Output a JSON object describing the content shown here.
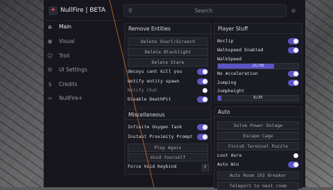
{
  "app": {
    "title": "NullFire | BETA",
    "logo_glyph": "✦"
  },
  "sidebar": {
    "items": [
      {
        "label": "Main",
        "icon": "home-icon",
        "glyph": "⌂",
        "active": true
      },
      {
        "label": "Visual",
        "icon": "eye-icon",
        "glyph": "◉",
        "active": false
      },
      {
        "label": "Troll",
        "icon": "ghost-icon",
        "glyph": "☺",
        "active": false
      },
      {
        "label": "UI Settings",
        "icon": "gear-icon",
        "glyph": "⚙",
        "active": false
      },
      {
        "label": "Credits",
        "icon": "dollar-icon",
        "glyph": "$",
        "active": false
      },
      {
        "label": "NullFire+",
        "icon": "link-icon",
        "glyph": "∞",
        "active": false
      }
    ]
  },
  "search": {
    "placeholder": "Search",
    "icon": "search-icon"
  },
  "remove_entities": {
    "title": "Remove Entities",
    "buttons": [
      "Delete Snarl/Screech",
      "Delete Blacklight",
      "Delete Stare"
    ],
    "toggles": [
      {
        "label": "decoys cant kill you",
        "on": true
      },
      {
        "label": "Notify entity spawn",
        "on": true
      },
      {
        "label": "Notify Chat",
        "on": false
      },
      {
        "label": "Disable DeathPit",
        "on": true
      }
    ]
  },
  "miscellaneous": {
    "title": "Miscellaneous",
    "toggles": [
      {
        "label": "Infinite Oxygen Tank",
        "on": true
      },
      {
        "label": "Instant Proximity Prompt",
        "on": true
      }
    ],
    "buttons": [
      "Play Again",
      "Void Yourself"
    ],
    "keybind": {
      "label": "Force Void Keybind",
      "key": "F"
    }
  },
  "player_stuff": {
    "title": "Player Stuff",
    "noclip": {
      "label": "Noclip",
      "on": true
    },
    "walkspeed_enabled": {
      "label": "Walkspeed Enabled",
      "on": true
    },
    "walkspeed": {
      "label": "WalkSpeed",
      "value": "21/30",
      "fraction": 0.7
    },
    "no_acceleration": {
      "label": "No Acceleration",
      "on": true
    },
    "jumping": {
      "label": "Jumping",
      "on": true
    },
    "jumpheight": {
      "label": "Jumpheight",
      "value": "6/25",
      "fraction": 0.04
    }
  },
  "auto": {
    "title": "Auto",
    "buttons": [
      "Solve Power Outage",
      "Escape Cage",
      "Finish Terminal Puzzle"
    ],
    "loot_aura": {
      "label": "Loot Aura",
      "on": false
    },
    "auto_win": {
      "label": "Auto Win",
      "on": true
    },
    "buttons2": [
      "Auto Room 193 Breaker",
      "Teleport to next room"
    ]
  },
  "colors": {
    "accent": "#5b55c4",
    "bg": "#16161c",
    "panel": "#1a1a22"
  }
}
